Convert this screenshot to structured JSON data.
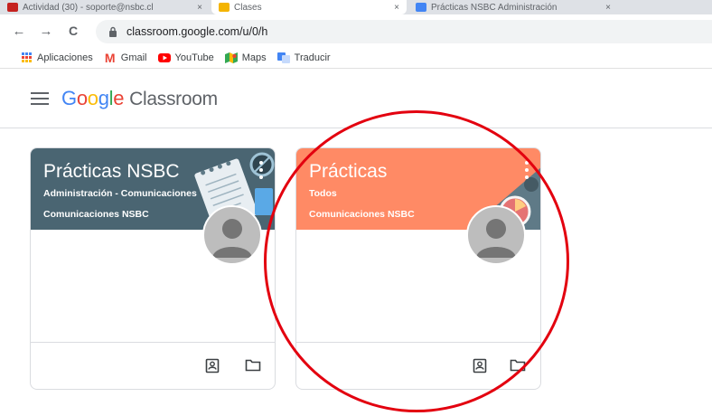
{
  "browser": {
    "tabs": [
      {
        "label": "Actividad (30) - soporte@nsbc.cl",
        "color": "#c5221f"
      },
      {
        "label": "Clases",
        "color": "#f4b400"
      },
      {
        "label": "Prácticas NSBC Administración",
        "color": "#4285f4"
      }
    ],
    "tab_close": "×",
    "url": "classroom.google.com/u/0/h",
    "back_icon": "←",
    "forward_icon": "→",
    "reload_icon": "C"
  },
  "bookmarks": [
    {
      "label": "Aplicaciones",
      "icon": "apps-grid-icon"
    },
    {
      "label": "Gmail",
      "icon": "gmail-icon",
      "glyph": "M"
    },
    {
      "label": "YouTube",
      "icon": "youtube-icon"
    },
    {
      "label": "Maps",
      "icon": "maps-icon"
    },
    {
      "label": "Traducir",
      "icon": "translate-icon"
    }
  ],
  "header": {
    "logo_letters": [
      "G",
      "o",
      "o",
      "g",
      "l",
      "e"
    ],
    "product": "Classroom"
  },
  "courses": [
    {
      "title": "Prácticas NSBC",
      "section": "Administración - Comunicaciones",
      "teacher": "Comunicaciones NSBC",
      "banner_color": "#4a6572"
    },
    {
      "title": "Prácticas",
      "section": "Todos",
      "teacher": "Comunicaciones NSBC",
      "banner_color": "#ff8a65"
    }
  ],
  "colors": {
    "annotation": "#e3000f"
  }
}
